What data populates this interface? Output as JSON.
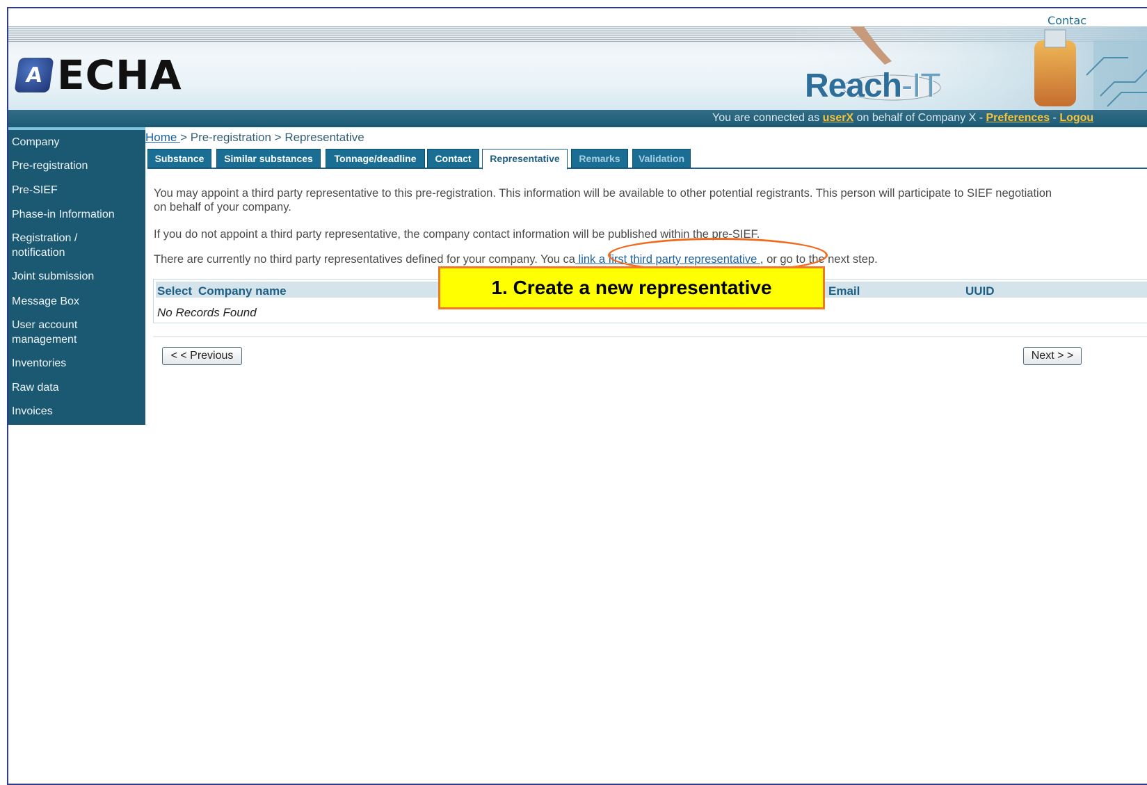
{
  "header": {
    "contact": "Contac",
    "logo_text": "ECHA",
    "app_title_main": "Reach",
    "app_title_suffix": "-IT",
    "conn_prefix": "You are connected as",
    "conn_user": "userX",
    "conn_middle": "on behalf of Company X -",
    "conn_preferences": "Preferences",
    "conn_sep": "-",
    "conn_logout": "Logou"
  },
  "sidebar": {
    "items": [
      "Company",
      "Pre-registration",
      "Pre-SIEF",
      "Phase-in Information",
      "Registration / notification",
      "Joint submission",
      "Message Box",
      "User account management",
      "Inventories",
      "Raw data",
      "Invoices"
    ]
  },
  "breadcrumb": {
    "home": "Home ",
    "rest": "> Pre-registration > Representative"
  },
  "tabs": [
    "Substance",
    "Similar substances",
    "Tonnage/deadline",
    "Contact",
    "Representative",
    "Remarks",
    "Validation"
  ],
  "main": {
    "para1": "You may appoint a third party representative to this pre-registration. This information will be available to other potential registrants. This person will participate to SIEF negotiation on behalf of your company.",
    "para2": "If you do not appoint a third party representative, the company contact information will be published within the pre-SIEF.",
    "para3_prefix": "There are currently no third party representatives defined for your company. You ca",
    "para3_link": " link a first third party representative ",
    "para3_suffix": ", or go to the next step."
  },
  "table": {
    "headers": [
      "Select",
      "Company name",
      "Email",
      "UUID"
    ],
    "empty_text": "No Records Found"
  },
  "nav": {
    "previous": "< < Previous",
    "next": "Next > >"
  },
  "callout": {
    "text": "1. Create a new representative"
  },
  "colors": {
    "sidebar_bg": "#1b5871",
    "tab_bg": "#1a6d93",
    "callout_bg": "#ffff00",
    "callout_border": "#f07a24",
    "accent_link": "#f3c441"
  }
}
